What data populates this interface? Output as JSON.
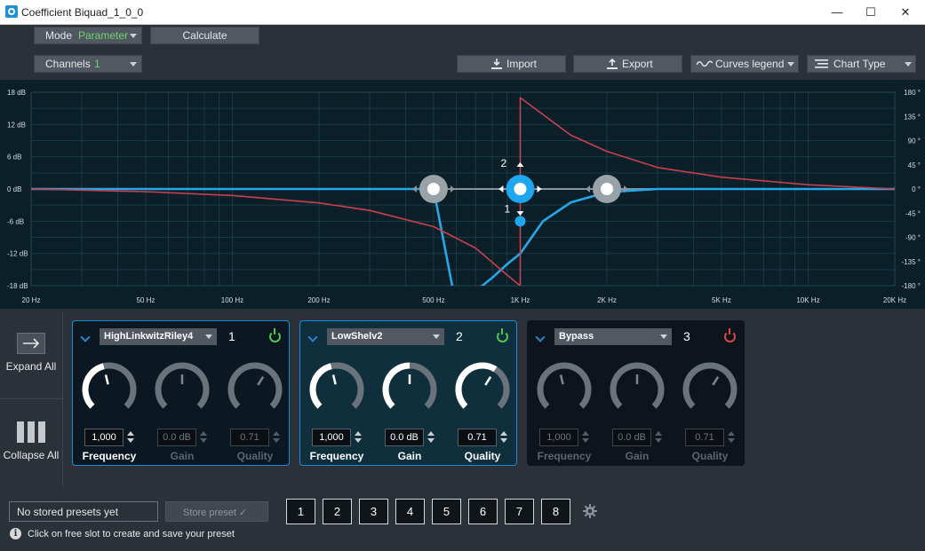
{
  "window": {
    "title": "Coefficient Biquad_1_0_0",
    "controls": [
      "—",
      "☐",
      "✕"
    ]
  },
  "toolbar": {
    "mode_label": "Mode",
    "mode_value": "Parameter",
    "calculate_label": "Calculate",
    "channels_label": "Channels",
    "channels_value": "1",
    "import_label": "Import",
    "export_label": "Export",
    "curves_legend_label": "Curves legend",
    "chart_type_label": "Chart Type"
  },
  "chart_data": {
    "type": "line",
    "x_scale": "log",
    "xlim": [
      20,
      20000
    ],
    "ylim_db": [
      -18,
      18
    ],
    "ylim_phase": [
      -180,
      180
    ],
    "x_ticks": [
      {
        "value": 20,
        "label": "20 Hz"
      },
      {
        "value": 50,
        "label": "50 Hz"
      },
      {
        "value": 100,
        "label": "100 Hz"
      },
      {
        "value": 200,
        "label": "200 Hz"
      },
      {
        "value": 500,
        "label": "500 Hz"
      },
      {
        "value": 1000,
        "label": "1K Hz"
      },
      {
        "value": 2000,
        "label": "2K Hz"
      },
      {
        "value": 5000,
        "label": "5K Hz"
      },
      {
        "value": 10000,
        "label": "10K Hz"
      },
      {
        "value": 20000,
        "label": "20K Hz"
      }
    ],
    "y_left_ticks": [
      {
        "value": 18,
        "label": "18 dB"
      },
      {
        "value": 12,
        "label": "12 dB"
      },
      {
        "value": 6,
        "label": "6 dB"
      },
      {
        "value": 0,
        "label": "0 dB"
      },
      {
        "value": -6,
        "label": "-6 dB"
      },
      {
        "value": -12,
        "label": "-12 dB"
      },
      {
        "value": -18,
        "label": "-18 dB"
      }
    ],
    "y_right_ticks": [
      {
        "value": 180,
        "label": "180 °"
      },
      {
        "value": 135,
        "label": "135 °"
      },
      {
        "value": 90,
        "label": "90 °"
      },
      {
        "value": 45,
        "label": "45 °"
      },
      {
        "value": 0,
        "label": "0 °"
      },
      {
        "value": -45,
        "label": "-45 °"
      },
      {
        "value": -90,
        "label": "-90 °"
      },
      {
        "value": -135,
        "label": "-135 °"
      },
      {
        "value": -180,
        "label": "-180 °"
      }
    ],
    "grid": true,
    "series": [
      {
        "axis": "db",
        "color": "#28a7e8",
        "x": [
          20,
          50,
          100,
          200,
          500,
          600,
          700,
          800,
          900,
          1000,
          1200,
          1500,
          2000,
          3000,
          5000,
          10000,
          20000
        ],
        "y": [
          0,
          0,
          0,
          0,
          0,
          -22,
          -19,
          -16.5,
          -14,
          -12,
          -6,
          -2.5,
          -0.6,
          0,
          0,
          0,
          0
        ]
      },
      {
        "axis": "phase",
        "color": "#c9404e",
        "x": [
          20,
          50,
          100,
          200,
          300,
          500,
          700,
          900,
          1000,
          1000.1,
          1500,
          2000,
          3000,
          5000,
          10000,
          20000
        ],
        "y": [
          0,
          -5,
          -12,
          -26,
          -40,
          -70,
          -110,
          -160,
          -180,
          170,
          100,
          70,
          40,
          22,
          8,
          0
        ]
      }
    ],
    "handles": [
      {
        "freq": 500,
        "gain": 0,
        "label": "",
        "active": false
      },
      {
        "freq": 1000,
        "gain": 0,
        "label": "2",
        "active": true
      },
      {
        "freq": 2000,
        "gain": 0,
        "label": "",
        "active": false
      }
    ],
    "marker": {
      "freq": 1000,
      "gain": -6,
      "label": "1"
    }
  },
  "sidebar": {
    "expand_label": "Expand All",
    "collapse_label": "Collapse All"
  },
  "bands": [
    {
      "type": "HighLinkwitzRiley4",
      "number": "1",
      "power": "on",
      "enabled_fields": [
        true,
        false,
        false
      ],
      "frequency": "1,000",
      "gain": "0.0 dB",
      "quality": "0.71",
      "labels": [
        "Frequency",
        "Gain",
        "Quality"
      ],
      "knob_levels": [
        0.45,
        0.5,
        0.62
      ]
    },
    {
      "type": "LowShelv2",
      "number": "2",
      "power": "on",
      "enabled_fields": [
        true,
        true,
        true
      ],
      "frequency": "1,000",
      "gain": "0.0 dB",
      "quality": "0.71",
      "labels": [
        "Frequency",
        "Gain",
        "Quality"
      ],
      "knob_levels": [
        0.45,
        0.5,
        0.62
      ]
    },
    {
      "type": "Bypass",
      "number": "3",
      "power": "off",
      "enabled_fields": [
        false,
        false,
        false
      ],
      "frequency": "1,000",
      "gain": "0.0 dB",
      "quality": "0.71",
      "labels": [
        "Frequency",
        "Gain",
        "Quality"
      ],
      "knob_levels": [
        0.45,
        0.5,
        0.62
      ]
    }
  ],
  "presets": {
    "status": "No stored presets yet",
    "store_label": "Store preset ✓",
    "slots": [
      "1",
      "2",
      "3",
      "4",
      "5",
      "6",
      "7",
      "8"
    ],
    "hint": "Click on free slot to create and save your preset"
  }
}
